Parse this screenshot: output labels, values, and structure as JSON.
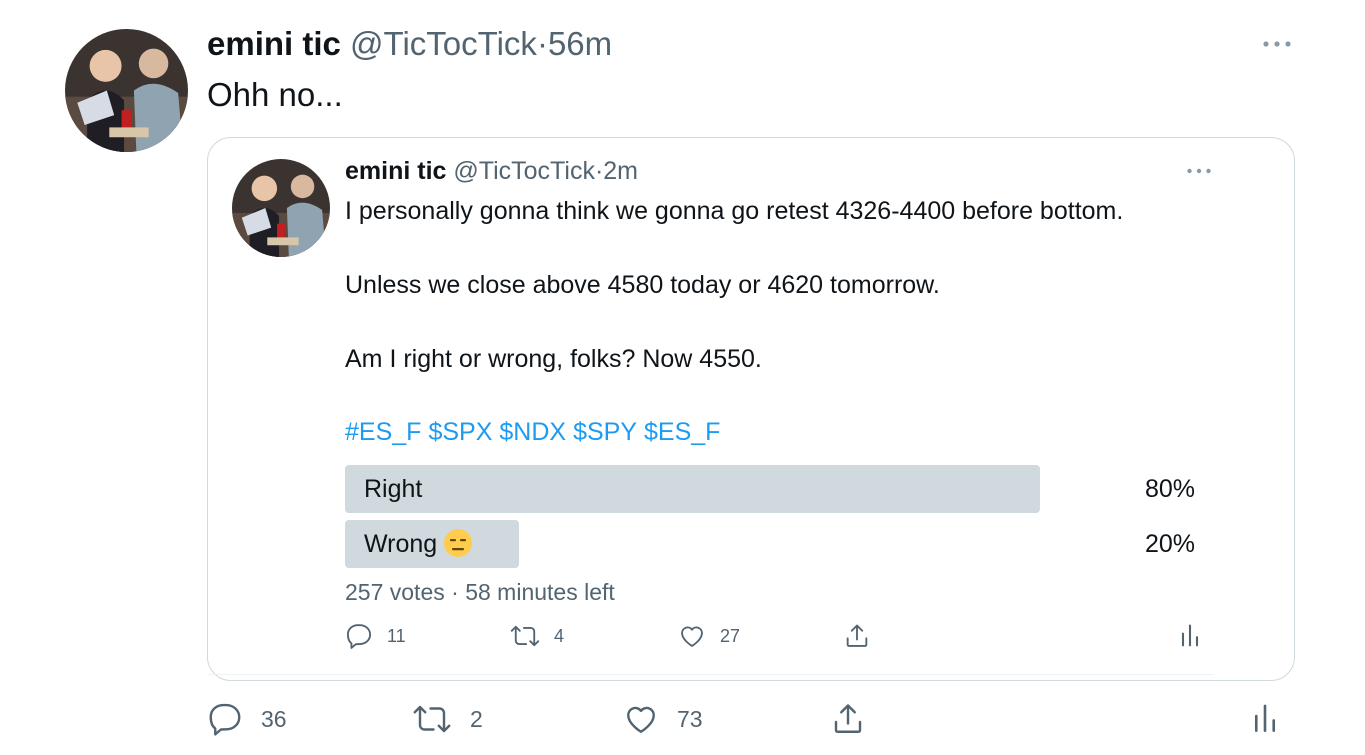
{
  "outer_tweet": {
    "display_name": "emini tic",
    "handle": "@TicTocTick",
    "separator": "·",
    "time": "56m",
    "text": "Ohh no...",
    "actions": {
      "reply_count": "36",
      "retweet_count": "2",
      "like_count": "73"
    }
  },
  "quoted_tweet": {
    "display_name": "emini tic",
    "handle": "@TicTocTick",
    "separator": "·",
    "time": "2m",
    "lines": [
      "I personally gonna think we gonna go retest 4326-4400 before bottom.",
      "Unless we close above 4580 today or 4620 tomorrow.",
      "Am I right or wrong, folks? Now 4550."
    ],
    "hashtags": [
      "#ES_F",
      "$SPX",
      "$NDX",
      "$SPY",
      "$ES_F"
    ],
    "poll": {
      "options": [
        {
          "label": "Right",
          "percent_label": "80%",
          "fraction": 0.8
        },
        {
          "label": "Wrong",
          "percent_label": "20%",
          "fraction": 0.2
        }
      ],
      "votes": "257 votes",
      "separator": "·",
      "time_left": "58 minutes left"
    },
    "actions": {
      "reply_count": "11",
      "retweet_count": "4",
      "like_count": "27"
    }
  },
  "colors": {
    "link": "#1d9bf0",
    "muted": "#536471",
    "poll_bar": "#cfd9de",
    "border": "#cfd9de"
  }
}
